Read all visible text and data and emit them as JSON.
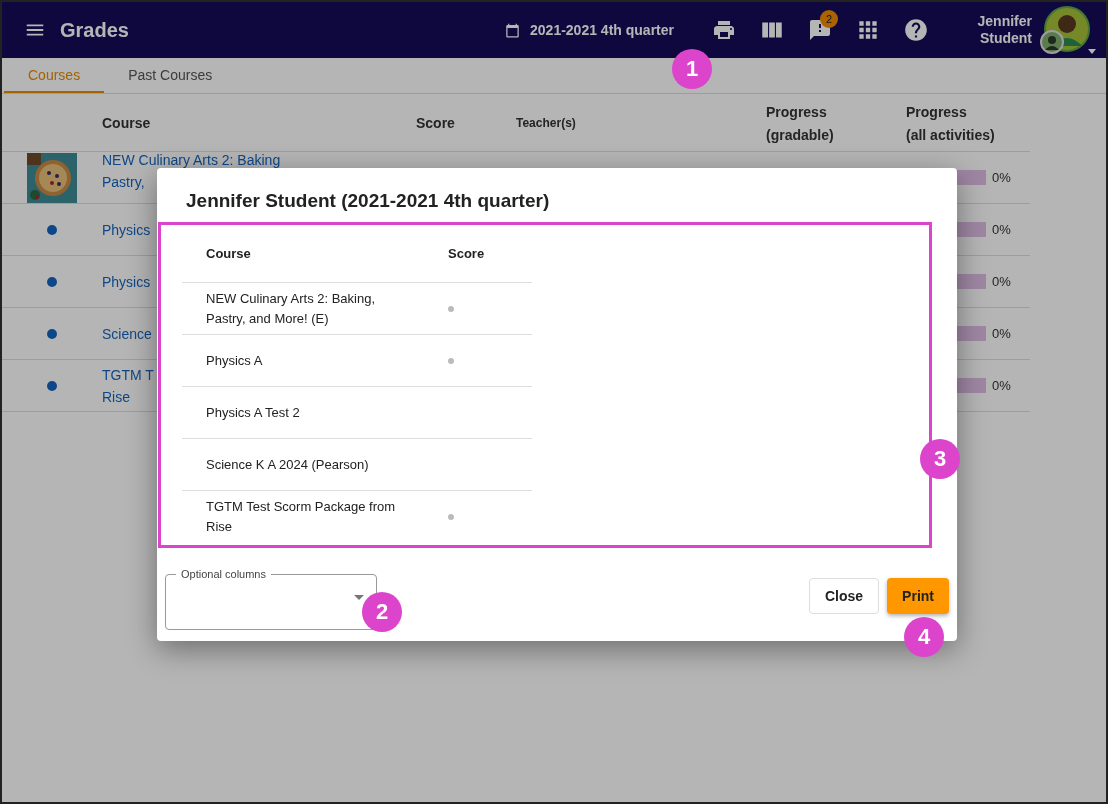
{
  "header": {
    "title": "Grades",
    "term": "2021-2021 4th quarter",
    "notification_count": "2",
    "user_name": "Jennifer Student"
  },
  "tabs": [
    {
      "label": "Courses",
      "selected": true
    },
    {
      "label": "Past Courses",
      "selected": false
    }
  ],
  "table": {
    "columns": [
      "Course",
      "Score",
      "Teacher(s)",
      "Progress\n(gradable)",
      "Progress\n(all activities)"
    ],
    "rows": [
      {
        "kind": "picture",
        "course": "NEW Culinary Arts 2: Baking\nPastry,",
        "progress_all": {
          "level": 0,
          "reading": "0%"
        }
      },
      {
        "kind": "dot",
        "course": "Physics",
        "progress_all": {
          "level": 0,
          "reading": "0%"
        }
      },
      {
        "kind": "dot",
        "course": "Physics",
        "progress_all": {
          "level": 0,
          "reading": "0%"
        }
      },
      {
        "kind": "dot",
        "course": "Science",
        "progress_all": {
          "level": 0,
          "reading": "0%"
        }
      },
      {
        "kind": "dot",
        "course": "TGTM T\nRise",
        "progress_all": {
          "level": 0,
          "reading": "0%"
        }
      }
    ]
  },
  "dialog": {
    "title": "Jennifer Student (2021-2021 4th quarter)",
    "columns": [
      "Course",
      "Score"
    ],
    "rows": [
      {
        "course": "NEW Culinary Arts 2: Baking, Pastry, and More! (E)",
        "score_marker": true
      },
      {
        "course": "Physics A",
        "score_marker": true
      },
      {
        "course": "Physics A Test 2",
        "score_marker": false
      },
      {
        "course": "Science K A 2024 (Pearson)",
        "score_marker": false
      },
      {
        "course": "TGTM Test Scorm Package from Rise",
        "score_marker": true
      }
    ],
    "optional_columns": {
      "label": "Optional columns"
    },
    "buttons": [
      {
        "label": "Close",
        "kind": "secondary"
      },
      {
        "label": "Print",
        "kind": "primary"
      }
    ]
  },
  "callouts": [
    "1",
    "2",
    "3",
    "4"
  ]
}
